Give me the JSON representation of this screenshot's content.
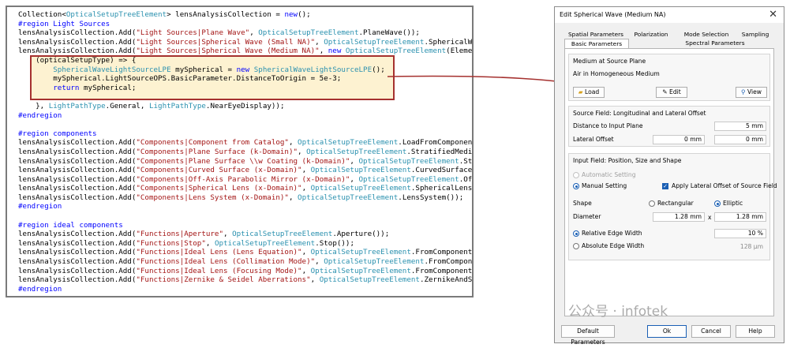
{
  "code": {
    "lines": [
      [
        [
          "plain",
          "Collection<"
        ],
        [
          "typ",
          "OpticalSetupTreeElement"
        ],
        [
          "plain",
          "> lensAnalysisCollection = "
        ],
        [
          "kw",
          "new"
        ],
        [
          "plain",
          "();"
        ]
      ],
      [
        [
          "kw",
          "#region Light Sources"
        ]
      ],
      [
        [
          "plain",
          "lensAnalysisCollection.Add("
        ],
        [
          "str",
          "\"Light Sources|Plane Wave\""
        ],
        [
          "plain",
          ", "
        ],
        [
          "typ",
          "OpticalSetupTreeElement"
        ],
        [
          "plain",
          ".PlaneWave());"
        ]
      ],
      [
        [
          "plain",
          "lensAnalysisCollection.Add("
        ],
        [
          "str",
          "\"Light Sources|Spherical Wave (Small NA)\""
        ],
        [
          "plain",
          ", "
        ],
        [
          "typ",
          "OpticalSetupTreeElement"
        ],
        [
          "plain",
          ".SphericalWav"
        ]
      ],
      [
        [
          "plain",
          "lensAnalysisCollection.Add("
        ],
        [
          "str",
          "\"Light Sources|Spherical Wave (Medium NA)\""
        ],
        [
          "plain",
          ", "
        ],
        [
          "kw",
          "new"
        ],
        [
          "plain",
          " "
        ],
        [
          "typ",
          "OpticalSetupTreeElement"
        ],
        [
          "plain",
          "(Element"
        ]
      ],
      [
        [
          "plain",
          "    (opticalSetupType) => {"
        ]
      ],
      [
        [
          "plain",
          "        "
        ],
        [
          "typ",
          "SphericalWaveLightSourceLPE"
        ],
        [
          "plain",
          " mySpherical = "
        ],
        [
          "kw",
          "new"
        ],
        [
          "plain",
          " "
        ],
        [
          "typ",
          "SphericalWaveLightSourceLPE"
        ],
        [
          "plain",
          "();"
        ]
      ],
      [
        [
          "plain",
          "        mySpherical.LightSourceOPS.BasicParameter.DistanceToOrigin = 5e-3;"
        ]
      ],
      [
        [
          "plain",
          "        "
        ],
        [
          "kw",
          "return"
        ],
        [
          "plain",
          " mySpherical;"
        ]
      ],
      [
        [
          "plain",
          ""
        ]
      ],
      [
        [
          "plain",
          "    }, "
        ],
        [
          "typ",
          "LightPathType"
        ],
        [
          "plain",
          ".General, "
        ],
        [
          "typ",
          "LightPathType"
        ],
        [
          "plain",
          ".NearEyeDisplay));"
        ]
      ],
      [
        [
          "kw",
          "#endregion"
        ]
      ],
      [
        [
          "plain",
          ""
        ]
      ],
      [
        [
          "kw",
          "#region components"
        ]
      ],
      [
        [
          "plain",
          "lensAnalysisCollection.Add("
        ],
        [
          "str",
          "\"Components|Component from Catalog\""
        ],
        [
          "plain",
          ", "
        ],
        [
          "typ",
          "OpticalSetupTreeElement"
        ],
        [
          "plain",
          ".LoadFromComponentC"
        ]
      ],
      [
        [
          "plain",
          "lensAnalysisCollection.Add("
        ],
        [
          "str",
          "\"Components|Plane Surface (k-Domain)\""
        ],
        [
          "plain",
          ", "
        ],
        [
          "typ",
          "OpticalSetupTreeElement"
        ],
        [
          "plain",
          ".StratifiedMedia"
        ]
      ],
      [
        [
          "plain",
          "lensAnalysisCollection.Add("
        ],
        [
          "str",
          "\"Components|Plane Surface \\\\w Coating (k-Domain)\""
        ],
        [
          "plain",
          ", "
        ],
        [
          "typ",
          "OpticalSetupTreeElement"
        ],
        [
          "plain",
          ".Str"
        ]
      ],
      [
        [
          "plain",
          "lensAnalysisCollection.Add("
        ],
        [
          "str",
          "\"Components|Curved Surface (x-Domain)\""
        ],
        [
          "plain",
          ", "
        ],
        [
          "typ",
          "OpticalSetupTreeElement"
        ],
        [
          "plain",
          ".CurvedSurface("
        ]
      ],
      [
        [
          "plain",
          "lensAnalysisCollection.Add("
        ],
        [
          "str",
          "\"Components|Off-Axis Parabolic Mirror (x-Domain)\""
        ],
        [
          "plain",
          ", "
        ],
        [
          "typ",
          "OpticalSetupTreeElement"
        ],
        [
          "plain",
          ".Off"
        ]
      ],
      [
        [
          "plain",
          "lensAnalysisCollection.Add("
        ],
        [
          "str",
          "\"Components|Spherical Lens (x-Domain)\""
        ],
        [
          "plain",
          ", "
        ],
        [
          "typ",
          "OpticalSetupTreeElement"
        ],
        [
          "plain",
          ".SphericalLens("
        ]
      ],
      [
        [
          "plain",
          "lensAnalysisCollection.Add("
        ],
        [
          "str",
          "\"Components|Lens System (x-Domain)\""
        ],
        [
          "plain",
          ", "
        ],
        [
          "typ",
          "OpticalSetupTreeElement"
        ],
        [
          "plain",
          ".LensSystem());"
        ]
      ],
      [
        [
          "kw",
          "#endregion"
        ]
      ],
      [
        [
          "plain",
          ""
        ]
      ],
      [
        [
          "kw",
          "#region ideal components"
        ]
      ],
      [
        [
          "plain",
          "lensAnalysisCollection.Add("
        ],
        [
          "str",
          "\"Functions|Aperture\""
        ],
        [
          "plain",
          ", "
        ],
        [
          "typ",
          "OpticalSetupTreeElement"
        ],
        [
          "plain",
          ".Aperture());"
        ]
      ],
      [
        [
          "plain",
          "lensAnalysisCollection.Add("
        ],
        [
          "str",
          "\"Functions|Stop\""
        ],
        [
          "plain",
          ", "
        ],
        [
          "typ",
          "OpticalSetupTreeElement"
        ],
        [
          "plain",
          ".Stop());"
        ]
      ],
      [
        [
          "plain",
          "lensAnalysisCollection.Add("
        ],
        [
          "str",
          "\"Functions|Ideal Lens (Lens Equation)\""
        ],
        [
          "plain",
          ", "
        ],
        [
          "typ",
          "OpticalSetupTreeElement"
        ],
        [
          "plain",
          ".FromComponentCa"
        ]
      ],
      [
        [
          "plain",
          "lensAnalysisCollection.Add("
        ],
        [
          "str",
          "\"Functions|Ideal Lens (Collimation Mode)\""
        ],
        [
          "plain",
          ", "
        ],
        [
          "typ",
          "OpticalSetupTreeElement"
        ],
        [
          "plain",
          ".FromComponen"
        ]
      ],
      [
        [
          "plain",
          "lensAnalysisCollection.Add("
        ],
        [
          "str",
          "\"Functions|Ideal Lens (Focusing Mode)\""
        ],
        [
          "plain",
          ", "
        ],
        [
          "typ",
          "OpticalSetupTreeElement"
        ],
        [
          "plain",
          ".FromComponentCa"
        ]
      ],
      [
        [
          "plain",
          "lensAnalysisCollection.Add("
        ],
        [
          "str",
          "\"Functions|Zernike & Seidel Aberrations\""
        ],
        [
          "plain",
          ", "
        ],
        [
          "typ",
          "OpticalSetupTreeElement"
        ],
        [
          "plain",
          ".ZernikeAndSe"
        ]
      ],
      [
        [
          "kw",
          "#endregion"
        ]
      ]
    ]
  },
  "dialog": {
    "title": "Edit Spherical Wave (Medium NA)",
    "tabs_row1": [
      "Spatial Parameters",
      "Polarization",
      "Mode Selection",
      "Sampling"
    ],
    "tabs_row2": [
      "Basic Parameters",
      "Spectral Parameters"
    ],
    "medium": {
      "title": "Medium at Source Plane",
      "value": "Air in Homogeneous Medium",
      "load_label": "Load",
      "edit_label": "Edit",
      "view_label": "View"
    },
    "source_field": {
      "title": "Source Field: Longitudinal and Lateral Offset",
      "distance_label": "Distance to Input Plane",
      "distance_value": "5 mm",
      "lateral_label": "Lateral Offset",
      "lateral_x": "0 mm",
      "lateral_y": "0 mm"
    },
    "input_field": {
      "title": "Input Field: Position, Size and Shape",
      "auto_label": "Automatic Setting",
      "manual_label": "Manual Setting",
      "apply_label": "Apply Lateral Offset of Source Field",
      "shape_label": "Shape",
      "rect_label": "Rectangular",
      "elliptic_label": "Elliptic",
      "diameter_label": "Diameter",
      "diameter_x": "1.28 mm",
      "times": "x",
      "diameter_y": "1.28 mm",
      "rel_label": "Relative Edge Width",
      "rel_value": "10 %",
      "abs_label": "Absolute Edge Width",
      "abs_value": "128 µm"
    },
    "footer": {
      "default_label": "Default Parameters",
      "ok_label": "Ok",
      "cancel_label": "Cancel",
      "help_label": "Help"
    }
  },
  "watermark": "公众号 · infotek",
  "colors": {
    "keyword": "#0000ff",
    "string": "#a31515",
    "type": "#2b91af",
    "highlight_border": "#a5312f",
    "highlight_fill": "#fdf2d1",
    "accent": "#1a5fb4"
  },
  "icons": {
    "load": "folder-icon",
    "edit": "pencil-icon",
    "view": "magnifier-icon",
    "close": "close-icon"
  }
}
